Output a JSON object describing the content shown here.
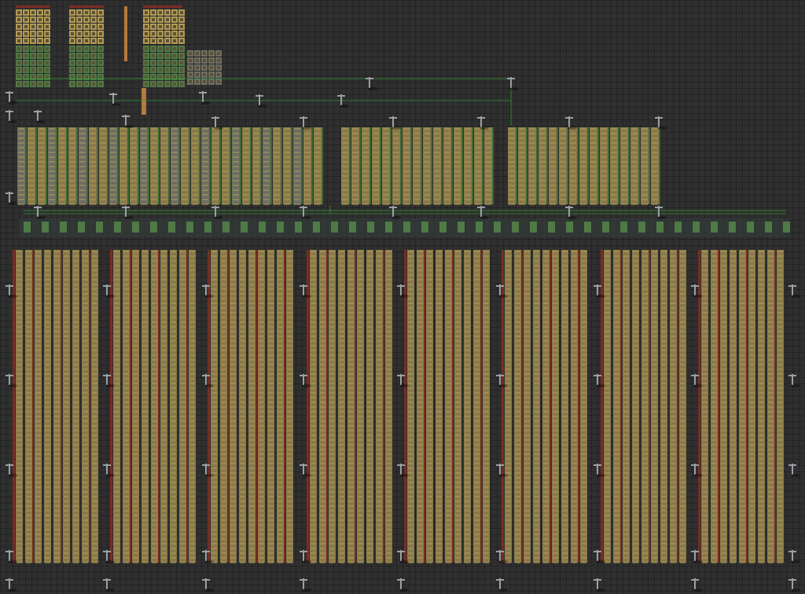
{
  "view": {
    "kind": "top-down factory game map view",
    "background": "#2f2f2f"
  },
  "palette": {
    "assembler_body": "#8a7a4a",
    "assembler_dark": "#5d5233",
    "assembler_light": "#b19a55",
    "grey_assembler": "#6e6e64",
    "belt_red": "#7a2c22",
    "pipe_green": "#3d6b38",
    "wire_green": "#36a43a",
    "pole_grey": "#9aa0a6",
    "beacon_green": "#4f7a46",
    "smelter_orange": "#b57a3c"
  },
  "icons": [
    "assembler-icon",
    "power-pole-icon",
    "belt-icon",
    "beacon-icon",
    "pipe-icon"
  ]
}
